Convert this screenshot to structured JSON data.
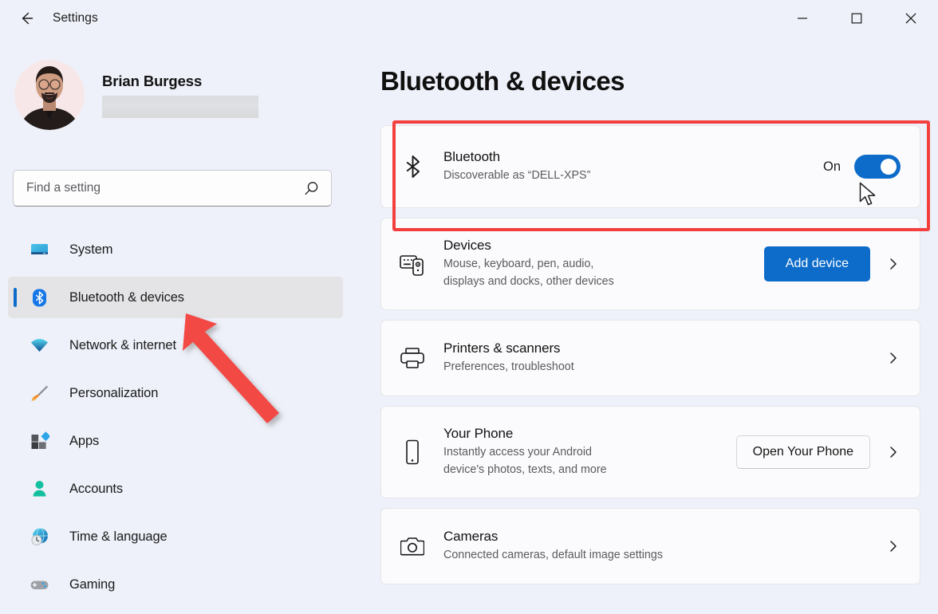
{
  "window": {
    "title": "Settings",
    "back_icon": "back-arrow-icon",
    "controls": {
      "minimize": "minimize-icon",
      "maximize": "maximize-icon",
      "close": "close-icon"
    }
  },
  "sidebar": {
    "account": {
      "name": "Brian Burgess",
      "email_redacted": true,
      "avatar": "user-avatar-photo"
    },
    "search": {
      "placeholder": "Find a setting",
      "value": "",
      "icon": "search-icon"
    },
    "items": [
      {
        "label": "System",
        "icon": "system-monitor-icon",
        "selected": false
      },
      {
        "label": "Bluetooth & devices",
        "icon": "bluetooth-icon",
        "selected": true
      },
      {
        "label": "Network & internet",
        "icon": "wifi-icon",
        "selected": false
      },
      {
        "label": "Personalization",
        "icon": "paintbrush-icon",
        "selected": false
      },
      {
        "label": "Apps",
        "icon": "apps-blocks-icon",
        "selected": false
      },
      {
        "label": "Accounts",
        "icon": "person-icon",
        "selected": false
      },
      {
        "label": "Time & language",
        "icon": "globe-clock-icon",
        "selected": false
      },
      {
        "label": "Gaming",
        "icon": "gamepad-icon",
        "selected": false
      }
    ]
  },
  "main": {
    "page_title": "Bluetooth & devices",
    "cards": [
      {
        "title": "Bluetooth",
        "subtitle": "Discoverable as “DELL-XPS”",
        "icon": "bluetooth-glyph-icon",
        "toggle": {
          "state_label": "On",
          "checked": true
        },
        "button": null,
        "chevron": false
      },
      {
        "title": "Devices",
        "subtitle": "Mouse, keyboard, pen, audio,\ndisplays and docks, other devices",
        "icon": "keyboard-mouse-icon",
        "toggle": null,
        "button": {
          "label": "Add device",
          "style": "accent"
        },
        "chevron": true
      },
      {
        "title": "Printers & scanners",
        "subtitle": "Preferences, troubleshoot",
        "icon": "printer-icon",
        "toggle": null,
        "button": null,
        "chevron": true
      },
      {
        "title": "Your Phone",
        "subtitle": "Instantly access your Android\ndevice's photos, texts, and more",
        "icon": "phone-icon",
        "toggle": null,
        "button": {
          "label": "Open Your Phone",
          "style": "plain"
        },
        "chevron": true
      },
      {
        "title": "Cameras",
        "subtitle": "Connected cameras, default image settings",
        "icon": "camera-icon",
        "toggle": null,
        "button": null,
        "chevron": true
      }
    ]
  },
  "annotations": {
    "highlight_box": {
      "target": "bluetooth-card",
      "color": "#F3403F"
    },
    "arrow": {
      "target": "sidebar-item-bluetooth-devices",
      "color": "#F24A45"
    },
    "cursor": {
      "target": "bluetooth-toggle",
      "icon": "mouse-pointer-icon"
    }
  },
  "colors": {
    "accent": "#0D6CC9",
    "background": "#EEF1F9",
    "card": "#FBFBFD",
    "annotation_red": "#F3403F"
  }
}
